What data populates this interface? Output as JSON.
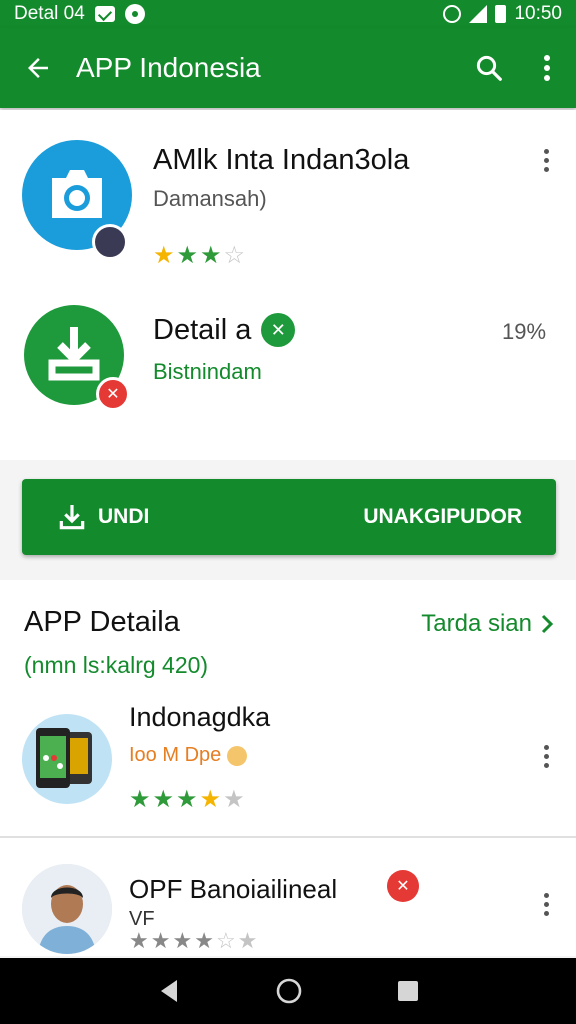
{
  "status_bar": {
    "left_text": "Detal 04",
    "time": "10:50"
  },
  "app_bar": {
    "title": "APP Indonesia",
    "icons": [
      "back-arrow-icon",
      "search-icon",
      "more-vert-icon"
    ]
  },
  "top_apps": [
    {
      "name": "AMlk Inta Indan3ola",
      "subtitle": "Damansah)",
      "rating": 3,
      "icon": "camera-app-icon",
      "colors": {
        "icon_bg": "#1b9ddb"
      }
    },
    {
      "name": "Detail a",
      "subtitle": "Bistnindam",
      "percent": "19%",
      "icon": "download-app-icon",
      "colors": {
        "icon_bg": "#1e9a3c",
        "badge": "#e53935"
      }
    }
  ],
  "install_button": {
    "left_label": "UNDI",
    "right_label": "UNAKGIPUDOR"
  },
  "details": {
    "title": "APP Detaila",
    "link_label": "Tarda sian",
    "subtitle": "(nmn ls:kalrg 420)",
    "items": [
      {
        "name": "Indonagdka",
        "meta": "Ioo M Dpe",
        "rating": 4,
        "icon": "phones-thumbnail"
      },
      {
        "name": "OPF Banoiailineal",
        "meta": "VF",
        "rating": 4,
        "icon": "person-avatar"
      }
    ]
  },
  "colors": {
    "primary": "#138a2c",
    "accent_red": "#e53935",
    "star_gold": "#f4b400"
  }
}
